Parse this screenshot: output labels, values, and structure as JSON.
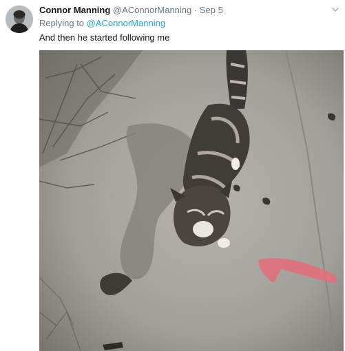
{
  "tweet": {
    "author_name": "Connor Manning",
    "author_handle": "@AConnorManning",
    "separator": "·",
    "timestamp": "Sep 5",
    "replying_prefix": "Replying to",
    "replying_handle": "@AConnorManning",
    "text": "And then he started following me"
  },
  "icons": {
    "menu": "chevron-down-icon",
    "avatar": "avatar"
  },
  "colors": {
    "name": "#14171a",
    "meta": "#657786",
    "link": "#1da1f2",
    "text": "#14171a"
  }
}
